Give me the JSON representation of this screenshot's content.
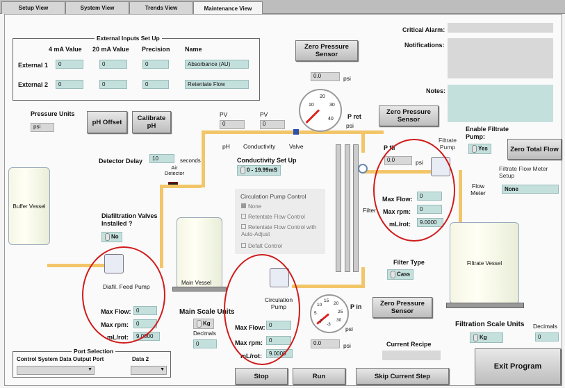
{
  "tabs": [
    "Setup View",
    "System View",
    "Trends View",
    "Maintenance View"
  ],
  "external_inputs": {
    "title": "External Inputs Set Up",
    "headers": [
      "4 mA Value",
      "20 mA Value",
      "Precision",
      "Name"
    ],
    "rows": [
      {
        "label": "External 1",
        "v4": "0",
        "v20": "0",
        "precision": "0",
        "name": "Absorbance (AU)"
      },
      {
        "label": "External 2",
        "v4": "0",
        "v20": "0",
        "precision": "0",
        "name": "Retentate Flow"
      }
    ]
  },
  "pressure_units": {
    "label": "Pressure Units",
    "value": "psi"
  },
  "buttons": {
    "ph_offset": "pH Offset",
    "calibrate_ph": "Calibrate pH",
    "zero_pressure": "Zero Pressure Sensor",
    "zero_total_flow": "Zero Total Flow",
    "exit": "Exit Program",
    "stop": "Stop",
    "run": "Run",
    "skip": "Skip Current Step"
  },
  "detector_delay": {
    "label": "Detector Delay",
    "value": "10",
    "unit": "seconds"
  },
  "air_detector": "Air Detector",
  "buffer_vessel": "Buffer Vessel",
  "main_vessel": "Main Vessel",
  "filtrate_vessel": "Filtrate Vessel",
  "diafiltration": {
    "label": "Diafiltration Valves Installed ?",
    "value": "No"
  },
  "feed_pump": {
    "label": "Diafil. Feed Pump",
    "max_flow_label": "Max Flow:",
    "max_flow": "0",
    "max_rpm_label": "Max rpm:",
    "max_rpm": "0",
    "ml_rot_label": "mL/rot:",
    "ml_rot": "9.0000"
  },
  "circ_pump": {
    "label": "Circulation Pump",
    "max_flow_label": "Max Flow:",
    "max_flow": "0",
    "max_rpm_label": "Max rpm:",
    "max_rpm": "0",
    "ml_rot_label": "mL/rot:",
    "ml_rot": "9.0000"
  },
  "filtrate_pump": {
    "label": "Filtrate Pump",
    "max_flow_label": "Max Flow:",
    "max_flow": "0",
    "max_rpm_label": "Max rpm:",
    "max_rpm": "0",
    "ml_rot_label": "mL/rot:",
    "ml_rot": "9.0000"
  },
  "pv": {
    "label": "PV",
    "ph_value": "0",
    "cond_value": "0"
  },
  "sensor_labels": {
    "ph": "pH",
    "conductivity": "Conductivity",
    "valve": "Valve"
  },
  "conductivity_setup": {
    "label": "Conductivity Set Up",
    "value": "0 - 19.99mS"
  },
  "circ_control": {
    "title": "Circulation Pump Control",
    "options": [
      "None",
      "Retentate Flow Control",
      "Retentate Flow Control with Auto-Adjust",
      "Defalt Control"
    ]
  },
  "pressure_top": {
    "value": "0.0",
    "unit": "psi"
  },
  "pressure_ret": {
    "label": "P ret",
    "unit": "psi",
    "ticks": [
      "10",
      "20",
      "30",
      "40"
    ]
  },
  "pressure_fil": {
    "label": "P fil",
    "value": "0.0",
    "unit": "psi"
  },
  "pressure_in": {
    "label": "P in",
    "value": "0.0",
    "unit": "psi",
    "ticks": [
      "10",
      "15",
      "20",
      "25",
      "30",
      "5",
      "-7",
      "-3"
    ]
  },
  "filter_label": "Filter",
  "filter_type": {
    "label": "Filter Type",
    "value": "Cass"
  },
  "flow_meter": "Flow Meter",
  "enable_filtrate": {
    "label": "Enable Filtrate Pump:",
    "value": "Yes"
  },
  "flow_meter_setup": {
    "label": "Filtrate Flow Meter Setup",
    "value": "None"
  },
  "critical_alarm": "Critical Alarm:",
  "notifications": "Notifications:",
  "notes": "Notes:",
  "main_scale": {
    "label": "Main Scale Units",
    "value": "Kg",
    "decimals_label": "Decimals",
    "decimals": "0"
  },
  "filtration_scale": {
    "label": "Filtration Scale Units",
    "value": "Kg",
    "decimals_label": "Decimals",
    "decimals": "0"
  },
  "current_recipe": "Current Recipe",
  "port_selection": {
    "title": "Port Selection",
    "output_label": "Control System Data Output Port",
    "data2_label": "Data 2",
    "output_value": "",
    "data2_value": ""
  }
}
